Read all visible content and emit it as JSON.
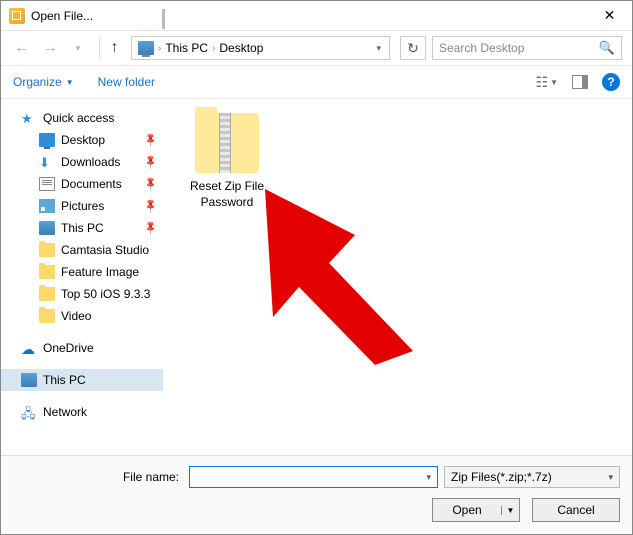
{
  "titlebar": {
    "title": "Open File..."
  },
  "nav": {
    "crumbs": [
      "This PC",
      "Desktop"
    ],
    "search_placeholder": "Search Desktop"
  },
  "toolbar": {
    "organize": "Organize",
    "new_folder": "New folder"
  },
  "sidebar": {
    "quick_access": "Quick access",
    "desktop": "Desktop",
    "downloads": "Downloads",
    "documents": "Documents",
    "pictures": "Pictures",
    "this_pc_q": "This PC",
    "camtasia": "Camtasia Studio",
    "feature": "Feature Image",
    "top50": "Top 50 iOS 9.3.3",
    "video": "Video",
    "onedrive": "OneDrive",
    "this_pc": "This PC",
    "network": "Network"
  },
  "content": {
    "file1": "Reset Zip File Password"
  },
  "bottom": {
    "filename_label": "File name:",
    "filename_value": "",
    "filter": "Zip Files(*.zip;*.7z)",
    "open": "Open",
    "cancel": "Cancel"
  }
}
